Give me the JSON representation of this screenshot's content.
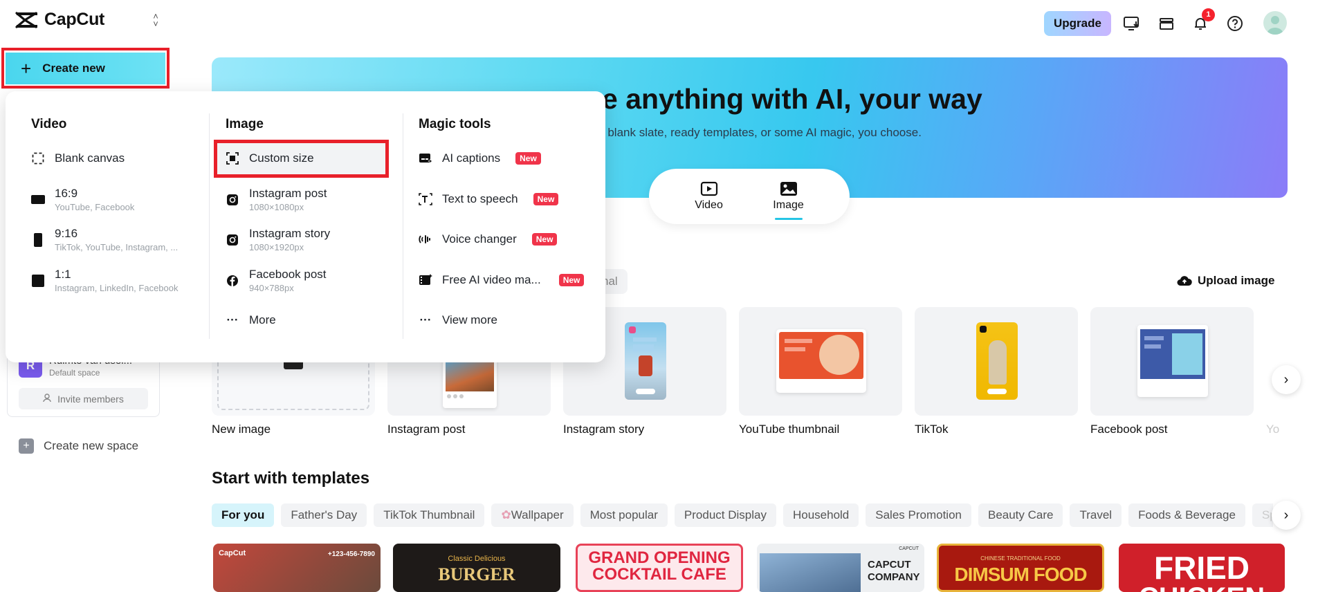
{
  "header": {
    "logo_text": "CapCut",
    "upgrade_label": "Upgrade",
    "notification_count": "1",
    "icons": [
      "monitor-download-icon",
      "stack-icon",
      "bell-icon",
      "help-icon"
    ]
  },
  "sidebar": {
    "create_new_label": "Create new",
    "space_initial": "R",
    "space_name": "Ruimte van usei...",
    "space_sub": "Default space",
    "invite_label": "Invite members",
    "create_space_label": "Create new space"
  },
  "dropdown": {
    "video": {
      "heading": "Video",
      "items": [
        {
          "label": "Blank canvas",
          "sub": ""
        },
        {
          "label": "16:9",
          "sub": "YouTube, Facebook"
        },
        {
          "label": "9:16",
          "sub": "TikTok, YouTube, Instagram, ..."
        },
        {
          "label": "1:1",
          "sub": "Instagram, LinkedIn, Facebook"
        }
      ]
    },
    "image": {
      "heading": "Image",
      "items": [
        {
          "label": "Custom size",
          "sub": ""
        },
        {
          "label": "Instagram post",
          "sub": "1080×1080px"
        },
        {
          "label": "Instagram story",
          "sub": "1080×1920px"
        },
        {
          "label": "Facebook post",
          "sub": "940×788px"
        },
        {
          "label": "More",
          "sub": ""
        }
      ]
    },
    "magic": {
      "heading": "Magic tools",
      "items": [
        {
          "label": "AI captions",
          "badge": "New"
        },
        {
          "label": "Text to speech",
          "badge": "New"
        },
        {
          "label": "Voice changer",
          "badge": "New"
        },
        {
          "label": "Free AI video ma...",
          "badge": "New"
        },
        {
          "label": "View more",
          "badge": ""
        }
      ]
    }
  },
  "hero": {
    "title": "e anything with AI, your way",
    "subtitle": "n a blank slate, ready templates, or some AI magic, you choose.",
    "tabs": [
      "Video",
      "Image"
    ]
  },
  "image_section": {
    "chip_text": "nal",
    "upload_label": "Upload image",
    "cards": [
      "New image",
      "Instagram post",
      "Instagram story",
      "YouTube thumbnail",
      "TikTok",
      "Facebook post",
      "Yo"
    ]
  },
  "templates": {
    "title": "Start with templates",
    "tabs": [
      "For you",
      "Father's Day",
      "TikTok Thumbnail",
      "Wallpaper",
      "Most popular",
      "Product Display",
      "Household",
      "Sales Promotion",
      "Beauty Care",
      "Travel",
      "Foods & Beverage",
      "Sprin"
    ],
    "thumb_texts": {
      "t1_logo": "CapCut",
      "t1_phone": "+123-456-7890",
      "t2_small": "Classic Delicious",
      "t2_big": "BURGER",
      "t3_line1": "GRAND OPENING",
      "t3_line2": "COCKTAIL CAFE",
      "t4_small": "CAPCUT",
      "t4_line1": "CAPCUT",
      "t4_line2": "COMPANY",
      "t5_small": "CHINESE TRADITIONAL FOOD",
      "t5_big": "DIMSUM FOOD",
      "t6_big": "FRIED",
      "t6_big2": "CHICKEN"
    }
  },
  "colors": {
    "accent": "#25c5e5",
    "highlight_red": "#e8202a",
    "badge_red": "#f0344a"
  }
}
